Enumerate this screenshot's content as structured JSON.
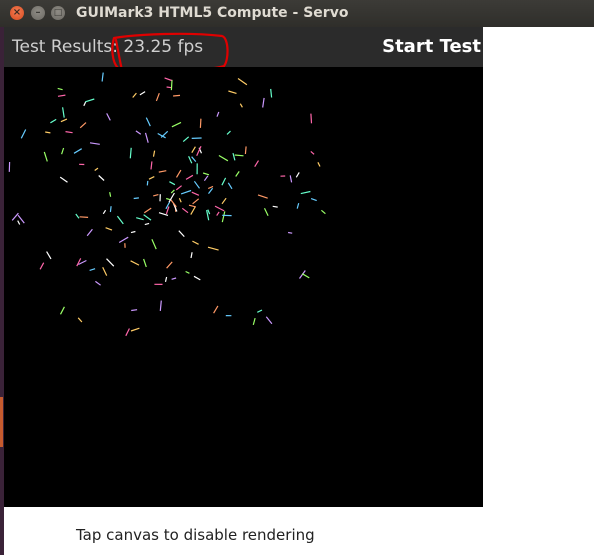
{
  "window": {
    "title": "GUIMark3 HTML5 Compute - Servo",
    "close_glyph": "×",
    "minimize_glyph": "–",
    "maximize_glyph": "□"
  },
  "header": {
    "results_label": "Test Results:",
    "fps_value": "23.25 fps",
    "start_button_label": "Start Test"
  },
  "footer": {
    "hint": "Tap canvas to disable rendering"
  },
  "colors": {
    "annotation": "#e00000",
    "canvas_background": "#000000",
    "header_background": "#2b2b2b",
    "particles": [
      "#66ccff",
      "#ff66aa",
      "#99ff66",
      "#ffcc66",
      "#cc99ff",
      "#ffffff",
      "#66ffcc",
      "#ff9966"
    ]
  }
}
